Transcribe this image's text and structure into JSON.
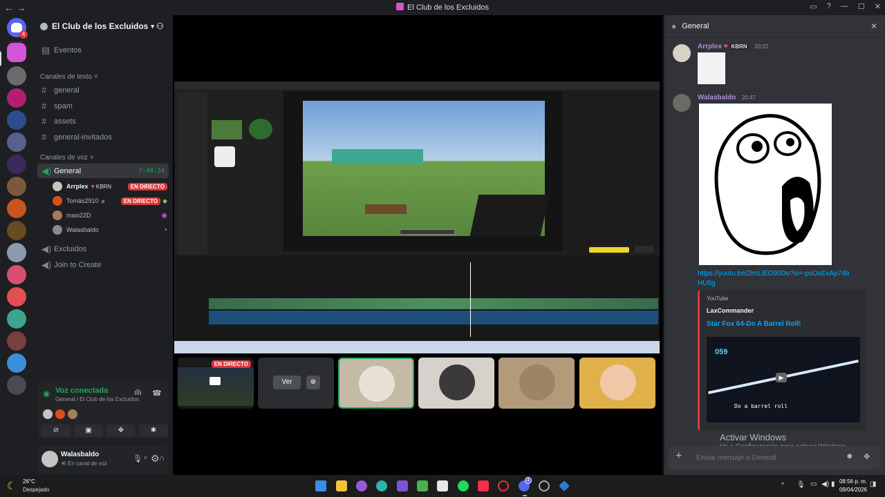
{
  "window": {
    "title": "El Club de los Excluidos",
    "back": "←",
    "forward": "→"
  },
  "rail": {
    "home_badge": "4"
  },
  "server": {
    "name": "El Club de los Excluidos",
    "events_label": "Eventos",
    "text_category": "Canales de texto",
    "text_channels": [
      "general",
      "spam",
      "assets",
      "general-invitados"
    ],
    "voice_category": "Canales de voz",
    "voice_channel": {
      "name": "General",
      "timer": "7:48:34"
    },
    "voice_users": [
      {
        "name": "Arrplex",
        "tag": "KBRN",
        "live": "EN DIRECTO"
      },
      {
        "name": "Tomás2910",
        "tag": "",
        "live": "EN DIRECTO"
      },
      {
        "name": "maxi22D",
        "tag": "",
        "live": ""
      },
      {
        "name": "Walasbaldo",
        "tag": "",
        "live": ""
      }
    ],
    "other_voice": [
      "Excluidos",
      "Join to Create"
    ]
  },
  "voice_panel": {
    "status": "Voz conectada",
    "location": "General / El Club de los Excluidos"
  },
  "user": {
    "name": "Walasbaldo",
    "status": "En canal de voz"
  },
  "stage": {
    "tiles": [
      {
        "label": "EN DIRECTO"
      },
      {
        "button": "Ver"
      }
    ]
  },
  "chat": {
    "channel": "General",
    "messages": [
      {
        "author": "Arrplex",
        "tag": "KBRN",
        "time": "20:22",
        "color": "#b08bdc"
      },
      {
        "author": "Walasbaldo",
        "time": "20:47",
        "color": "#b08bdc",
        "link": "https://youtu.be/2lmLlEO90Do?si=-psOsExAp74bHU6g",
        "embed": {
          "provider": "YouTube",
          "author": "LaxCommander",
          "title": "Star Fox 64-Do A Barrel Roll!",
          "hud_score": "059",
          "caption": "Do a barrel roll"
        }
      }
    ],
    "placeholder": "Enviar mensaje a General",
    "activate_title": "Activar Windows",
    "activate_sub": "Ve a Configuración para activar Windows."
  },
  "taskbar": {
    "temp": "26°C",
    "weather": "Despejado",
    "time": "08:56 p. m.",
    "date": "09/04/2026",
    "discord_badge": "4"
  }
}
